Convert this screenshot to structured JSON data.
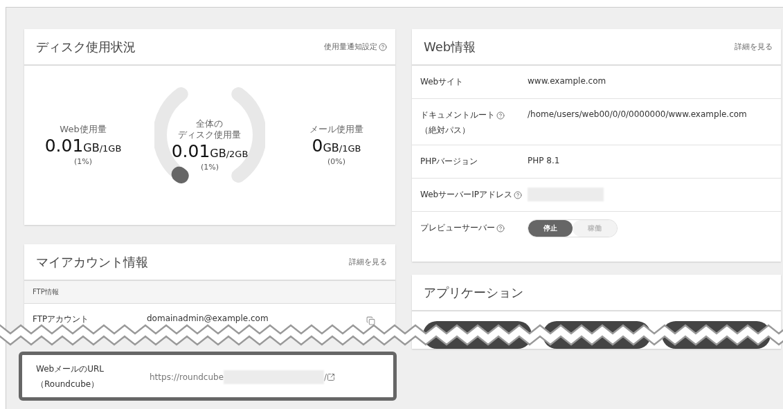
{
  "disk_usage": {
    "title": "ディスク使用状況",
    "link": "使用量通知設定",
    "web": {
      "label": "Web使用量",
      "value": "0.01",
      "unit": "GB",
      "total": "/1GB",
      "percent": "(1%)"
    },
    "total": {
      "label_lines": [
        "全体の",
        "ディスク使用量"
      ],
      "value": "0.01",
      "unit": "GB",
      "total": "/2GB",
      "percent": "(1%)"
    },
    "mail": {
      "label": "メール使用量",
      "value": "0",
      "unit": "GB",
      "total": "/1GB",
      "percent": "(0%)"
    }
  },
  "account": {
    "title": "マイアカウント情報",
    "link": "詳細を見る",
    "section": "FTP情報",
    "rows": [
      {
        "label": "FTPアカウント",
        "value": "domainadmin@example.com",
        "kind": "copy"
      }
    ],
    "highlighted_row": {
      "label": "WebメールのURL",
      "label2": "（Roundcube）",
      "value": "https://roundcube",
      "suffix": "/",
      "kind": "external"
    }
  },
  "web_info": {
    "title": "Web情報",
    "link": "詳細を見る",
    "rows": [
      {
        "label": "Webサイト",
        "kind": "text",
        "value": "www.example.com"
      },
      {
        "label": "ドキュメントルート",
        "label2": "（絶対パス）",
        "help": true,
        "kind": "text",
        "value": "/home/users/web00/0/0/0000000/www.example.com"
      },
      {
        "label": "PHPバージョン",
        "kind": "text",
        "value": "PHP 8.1"
      },
      {
        "label": "WebサーバーIPアドレス",
        "help": true,
        "kind": "redacted"
      },
      {
        "label": "プレビューサーバー",
        "help": true,
        "kind": "toggle",
        "options": [
          {
            "label": "停止",
            "selected": true
          },
          {
            "label": "稼働",
            "selected": false
          }
        ]
      }
    ]
  },
  "applications": {
    "title": "アプリケーション",
    "buttons": [
      {
        "kind": "pill"
      },
      {
        "kind": "pill"
      },
      {
        "kind": "pill"
      }
    ]
  }
}
